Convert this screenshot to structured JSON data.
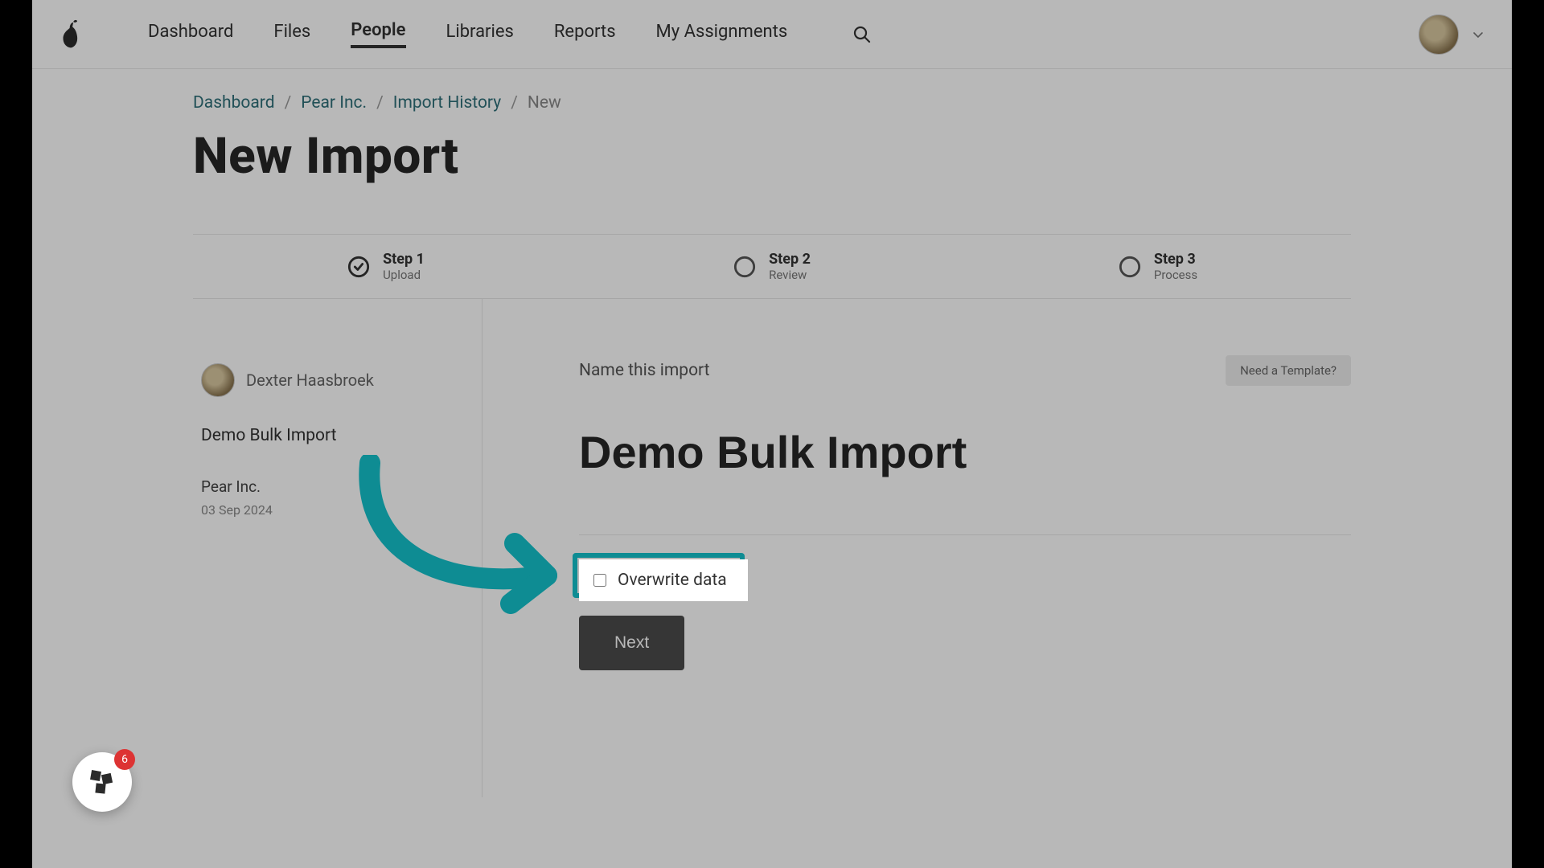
{
  "nav": {
    "items": [
      "Dashboard",
      "Files",
      "People",
      "Libraries",
      "Reports",
      "My Assignments"
    ],
    "active_index": 2
  },
  "breadcrumbs": {
    "links": [
      "Dashboard",
      "Pear Inc.",
      "Import History"
    ],
    "current": "New"
  },
  "page_title": "New Import",
  "steps": [
    {
      "title": "Step 1",
      "label": "Upload",
      "state": "done"
    },
    {
      "title": "Step 2",
      "label": "Review",
      "state": "pending"
    },
    {
      "title": "Step 3",
      "label": "Process",
      "state": "pending"
    }
  ],
  "sidebar": {
    "user_name": "Dexter Haasbroek",
    "import_name": "Demo Bulk Import",
    "org": "Pear Inc.",
    "date": "03 Sep 2024"
  },
  "main": {
    "name_label": "Name this import",
    "template_btn": "Need a Template?",
    "import_name_value": "Demo Bulk Import",
    "overwrite_label": "Overwrite data",
    "overwrite_checked": false,
    "next_label": "Next"
  },
  "widget": {
    "badge": "6"
  },
  "colors": {
    "accent_teal": "#0e8c93"
  }
}
